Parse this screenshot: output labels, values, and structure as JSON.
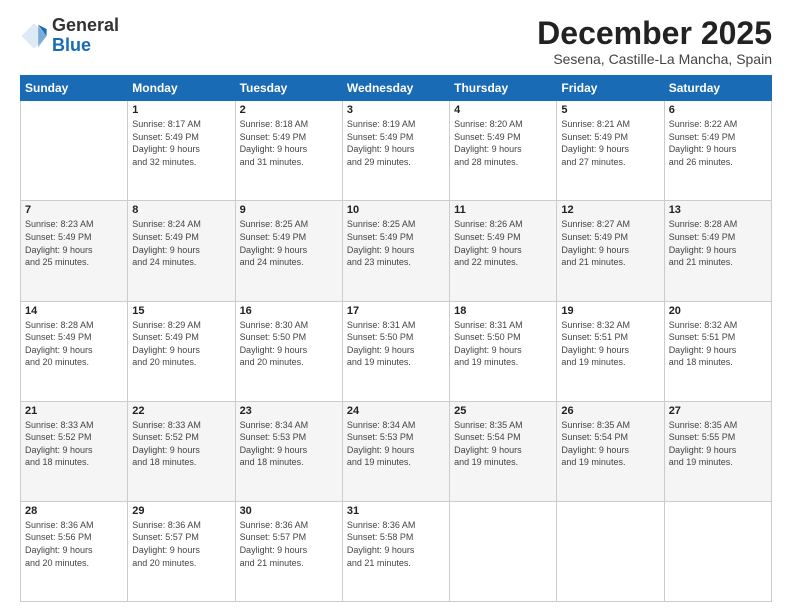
{
  "logo": {
    "general": "General",
    "blue": "Blue"
  },
  "header": {
    "month": "December 2025",
    "location": "Sesena, Castille-La Mancha, Spain"
  },
  "weekdays": [
    "Sunday",
    "Monday",
    "Tuesday",
    "Wednesday",
    "Thursday",
    "Friday",
    "Saturday"
  ],
  "weeks": [
    [
      {
        "day": "",
        "info": ""
      },
      {
        "day": "1",
        "info": "Sunrise: 8:17 AM\nSunset: 5:49 PM\nDaylight: 9 hours\nand 32 minutes."
      },
      {
        "day": "2",
        "info": "Sunrise: 8:18 AM\nSunset: 5:49 PM\nDaylight: 9 hours\nand 31 minutes."
      },
      {
        "day": "3",
        "info": "Sunrise: 8:19 AM\nSunset: 5:49 PM\nDaylight: 9 hours\nand 29 minutes."
      },
      {
        "day": "4",
        "info": "Sunrise: 8:20 AM\nSunset: 5:49 PM\nDaylight: 9 hours\nand 28 minutes."
      },
      {
        "day": "5",
        "info": "Sunrise: 8:21 AM\nSunset: 5:49 PM\nDaylight: 9 hours\nand 27 minutes."
      },
      {
        "day": "6",
        "info": "Sunrise: 8:22 AM\nSunset: 5:49 PM\nDaylight: 9 hours\nand 26 minutes."
      }
    ],
    [
      {
        "day": "7",
        "info": "Sunrise: 8:23 AM\nSunset: 5:49 PM\nDaylight: 9 hours\nand 25 minutes."
      },
      {
        "day": "8",
        "info": "Sunrise: 8:24 AM\nSunset: 5:49 PM\nDaylight: 9 hours\nand 24 minutes."
      },
      {
        "day": "9",
        "info": "Sunrise: 8:25 AM\nSunset: 5:49 PM\nDaylight: 9 hours\nand 24 minutes."
      },
      {
        "day": "10",
        "info": "Sunrise: 8:25 AM\nSunset: 5:49 PM\nDaylight: 9 hours\nand 23 minutes."
      },
      {
        "day": "11",
        "info": "Sunrise: 8:26 AM\nSunset: 5:49 PM\nDaylight: 9 hours\nand 22 minutes."
      },
      {
        "day": "12",
        "info": "Sunrise: 8:27 AM\nSunset: 5:49 PM\nDaylight: 9 hours\nand 21 minutes."
      },
      {
        "day": "13",
        "info": "Sunrise: 8:28 AM\nSunset: 5:49 PM\nDaylight: 9 hours\nand 21 minutes."
      }
    ],
    [
      {
        "day": "14",
        "info": "Sunrise: 8:28 AM\nSunset: 5:49 PM\nDaylight: 9 hours\nand 20 minutes."
      },
      {
        "day": "15",
        "info": "Sunrise: 8:29 AM\nSunset: 5:49 PM\nDaylight: 9 hours\nand 20 minutes."
      },
      {
        "day": "16",
        "info": "Sunrise: 8:30 AM\nSunset: 5:50 PM\nDaylight: 9 hours\nand 20 minutes."
      },
      {
        "day": "17",
        "info": "Sunrise: 8:31 AM\nSunset: 5:50 PM\nDaylight: 9 hours\nand 19 minutes."
      },
      {
        "day": "18",
        "info": "Sunrise: 8:31 AM\nSunset: 5:50 PM\nDaylight: 9 hours\nand 19 minutes."
      },
      {
        "day": "19",
        "info": "Sunrise: 8:32 AM\nSunset: 5:51 PM\nDaylight: 9 hours\nand 19 minutes."
      },
      {
        "day": "20",
        "info": "Sunrise: 8:32 AM\nSunset: 5:51 PM\nDaylight: 9 hours\nand 18 minutes."
      }
    ],
    [
      {
        "day": "21",
        "info": "Sunrise: 8:33 AM\nSunset: 5:52 PM\nDaylight: 9 hours\nand 18 minutes."
      },
      {
        "day": "22",
        "info": "Sunrise: 8:33 AM\nSunset: 5:52 PM\nDaylight: 9 hours\nand 18 minutes."
      },
      {
        "day": "23",
        "info": "Sunrise: 8:34 AM\nSunset: 5:53 PM\nDaylight: 9 hours\nand 18 minutes."
      },
      {
        "day": "24",
        "info": "Sunrise: 8:34 AM\nSunset: 5:53 PM\nDaylight: 9 hours\nand 19 minutes."
      },
      {
        "day": "25",
        "info": "Sunrise: 8:35 AM\nSunset: 5:54 PM\nDaylight: 9 hours\nand 19 minutes."
      },
      {
        "day": "26",
        "info": "Sunrise: 8:35 AM\nSunset: 5:54 PM\nDaylight: 9 hours\nand 19 minutes."
      },
      {
        "day": "27",
        "info": "Sunrise: 8:35 AM\nSunset: 5:55 PM\nDaylight: 9 hours\nand 19 minutes."
      }
    ],
    [
      {
        "day": "28",
        "info": "Sunrise: 8:36 AM\nSunset: 5:56 PM\nDaylight: 9 hours\nand 20 minutes."
      },
      {
        "day": "29",
        "info": "Sunrise: 8:36 AM\nSunset: 5:57 PM\nDaylight: 9 hours\nand 20 minutes."
      },
      {
        "day": "30",
        "info": "Sunrise: 8:36 AM\nSunset: 5:57 PM\nDaylight: 9 hours\nand 21 minutes."
      },
      {
        "day": "31",
        "info": "Sunrise: 8:36 AM\nSunset: 5:58 PM\nDaylight: 9 hours\nand 21 minutes."
      },
      {
        "day": "",
        "info": ""
      },
      {
        "day": "",
        "info": ""
      },
      {
        "day": "",
        "info": ""
      }
    ]
  ]
}
